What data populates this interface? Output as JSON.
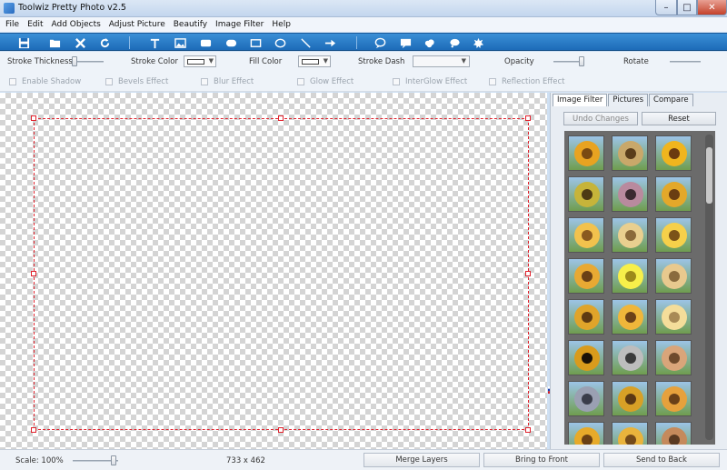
{
  "window": {
    "title": "Toolwiz Pretty Photo v2.5"
  },
  "menu": [
    "File",
    "Edit",
    "Add Objects",
    "Adjust Picture",
    "Beautify",
    "Image Filter",
    "Help"
  ],
  "tools": [
    "save-icon",
    "open-folder-icon",
    "close-x-icon",
    "refresh-icon",
    "text-icon",
    "image-icon",
    "rounded-rect-icon",
    "pill-icon",
    "rectangle-icon",
    "ellipse-icon",
    "line-icon",
    "arrow-icon",
    "speech-bubble-icon",
    "callout-icon",
    "cloud-icon",
    "thought-bubble-icon",
    "splat-icon"
  ],
  "props": {
    "stroke_thickness": "Stroke Thickness",
    "stroke_color": "Stroke Color",
    "fill_color": "Fill Color",
    "stroke_dash": "Stroke Dash",
    "opacity": "Opacity",
    "rotate": "Rotate"
  },
  "effects": [
    "Enable Shadow",
    "Bevels Effect",
    "Blur Effect",
    "Glow Effect",
    "InterGlow Effect",
    "Reflection Effect"
  ],
  "panel": {
    "tabs": [
      "Image Filter",
      "Pictures",
      "Compare"
    ],
    "undo_label": "Undo Changes",
    "reset_label": "Reset"
  },
  "thumb_filters": [
    [
      "#e8a321",
      "#7a4a12"
    ],
    [
      "#c9a86a",
      "#5a3d1a"
    ],
    [
      "#f0b51e",
      "#6b3a10"
    ],
    [
      "#c6b43a",
      "#4d3a14"
    ],
    [
      "#b98a9e",
      "#3b2a30"
    ],
    [
      "#e3a82a",
      "#6a3d12"
    ],
    [
      "#f2c24d",
      "#8a5a1f"
    ],
    [
      "#e9cf8f",
      "#8b6a3a"
    ],
    [
      "#f6d04a",
      "#7b5218"
    ],
    [
      "#e8a933",
      "#6a4016"
    ],
    [
      "#f7ef4a",
      "#9d8a1a"
    ],
    [
      "#e8c98e",
      "#8a6b3e"
    ],
    [
      "#e0a42a",
      "#5e3a12"
    ],
    [
      "#f0b63a",
      "#6b4018"
    ],
    [
      "#f4dd9a",
      "#a88a56"
    ],
    [
      "#d99b1c",
      "#1b1208"
    ],
    [
      "#bdbdbd",
      "#3a3a3a"
    ],
    [
      "#d9a57a",
      "#6e4a2c"
    ],
    [
      "#9aa0b2",
      "#3a3d4a"
    ],
    [
      "#d8a026",
      "#5a3814"
    ],
    [
      "#e6a13c",
      "#6a4018"
    ],
    [
      "#e7aa2a",
      "#6a4014"
    ],
    [
      "#e9b33c",
      "#744a1a"
    ],
    [
      "#c58a5c",
      "#5a3a22"
    ]
  ],
  "status": {
    "scale": "Scale: 100%",
    "size": "733 x 462",
    "merge": "Merge Layers",
    "front": "Bring to Front",
    "back": "Send to Back"
  }
}
